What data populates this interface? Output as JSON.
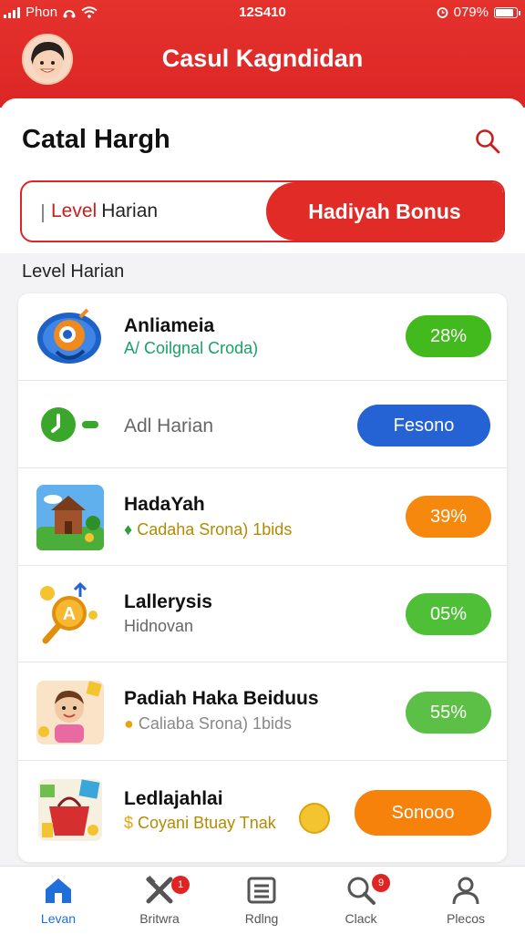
{
  "status_bar": {
    "carrier": "Phon",
    "time": "12S410",
    "battery": "079%"
  },
  "header": {
    "app_title": "Casul Kagndidan"
  },
  "page": {
    "title": "Catal Hargh"
  },
  "segmented": {
    "left_prefix": "Level",
    "left_label": "Harian",
    "right_label": "Hadiyah Bonus"
  },
  "section_title": "Level Harian",
  "items": [
    {
      "title": "Anliameia",
      "subtitle_prefix": "A/",
      "subtitle": "Coilgnal Croda)",
      "action": "28%",
      "color": "#42b91c"
    },
    {
      "title": "",
      "subtitle_prefix": "",
      "subtitle": "Adl Harian",
      "action": "Fesono",
      "color": "#2563d4"
    },
    {
      "title": "HadaYah",
      "subtitle_prefix": "",
      "subtitle": "Cadaha Srona)   1bids",
      "action": "39%",
      "color": "#f6890d"
    },
    {
      "title": "Lallerysis",
      "subtitle_prefix": "",
      "subtitle": "Hidnovan",
      "action": "05%",
      "color": "#4fbf38"
    },
    {
      "title": "Padiah Haka Beiduus",
      "subtitle_prefix": "",
      "subtitle": "Caliaba Srona)   1bids",
      "action": "55%",
      "color": "#5cc046"
    },
    {
      "title": "Ledlajahlai",
      "subtitle_prefix": "",
      "subtitle": "Coyani Btuay Tnak",
      "action": "Sonooo",
      "color": "#f6820c"
    }
  ],
  "tabs": [
    {
      "label": "Levan",
      "active": true,
      "badge": ""
    },
    {
      "label": "Britwra",
      "active": false,
      "badge": "1"
    },
    {
      "label": "Rdlng",
      "active": false,
      "badge": ""
    },
    {
      "label": "Clack",
      "active": false,
      "badge": "9"
    },
    {
      "label": "Plecos",
      "active": false,
      "badge": ""
    }
  ]
}
